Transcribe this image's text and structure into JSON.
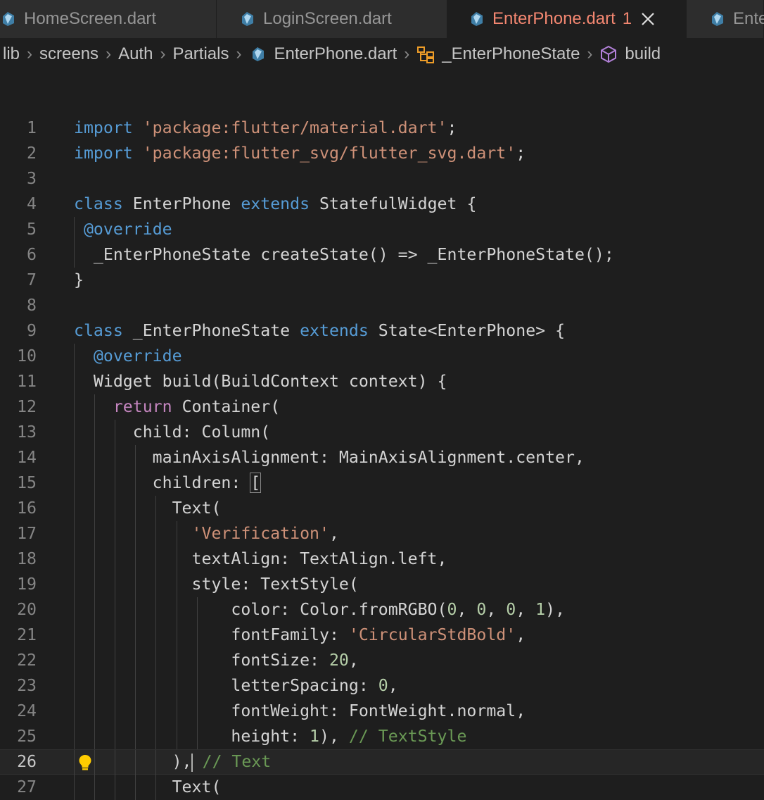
{
  "tabs": [
    {
      "label": "HomeScreen.dart",
      "active": false
    },
    {
      "label": "LoginScreen.dart",
      "active": false
    },
    {
      "label": "EnterPhone.dart",
      "active": true,
      "problems": "1"
    },
    {
      "label": "Ente",
      "active": false
    }
  ],
  "breadcrumb": {
    "items": [
      "lib",
      "screens",
      "Auth",
      "Partials",
      "EnterPhone.dart",
      "_EnterPhoneState",
      "build"
    ],
    "icons": [
      "",
      "",
      "",
      "",
      "dart-file-icon",
      "class-symbol-icon",
      "method-symbol-icon"
    ]
  },
  "editor": {
    "current_line": 26,
    "lines": [
      {
        "n": "1",
        "tokens": [
          [
            "kw",
            "import"
          ],
          [
            "",
            ""
          ],
          [
            "str",
            " 'package:flutter/material.dart'"
          ],
          [
            "",
            ";"
          ]
        ]
      },
      {
        "n": "2",
        "tokens": [
          [
            "kw",
            "import"
          ],
          [
            "str",
            " 'package:flutter_svg/flutter_svg.dart'"
          ],
          [
            "",
            ";"
          ]
        ]
      },
      {
        "n": "3",
        "tokens": []
      },
      {
        "n": "4",
        "tokens": [
          [
            "kw",
            "class"
          ],
          [
            "",
            " EnterPhone "
          ],
          [
            "kw",
            "extends"
          ],
          [
            "",
            " StatefulWidget {"
          ]
        ]
      },
      {
        "n": "5",
        "tokens": [
          [
            "",
            " "
          ],
          [
            "kw",
            "@override"
          ]
        ]
      },
      {
        "n": "6",
        "tokens": [
          [
            "",
            "  _EnterPhoneState createState() => _EnterPhoneState();"
          ]
        ]
      },
      {
        "n": "7",
        "tokens": [
          [
            "",
            "}"
          ]
        ]
      },
      {
        "n": "8",
        "tokens": []
      },
      {
        "n": "9",
        "tokens": [
          [
            "kw",
            "class"
          ],
          [
            "",
            " _EnterPhoneState "
          ],
          [
            "kw",
            "extends"
          ],
          [
            "",
            " State<EnterPhone> {"
          ]
        ]
      },
      {
        "n": "10",
        "tokens": [
          [
            "",
            "  "
          ],
          [
            "kw",
            "@override"
          ]
        ]
      },
      {
        "n": "11",
        "tokens": [
          [
            "",
            "  Widget build(BuildContext context) {"
          ]
        ]
      },
      {
        "n": "12",
        "tokens": [
          [
            "",
            "    "
          ],
          [
            "kw2",
            "return"
          ],
          [
            "",
            " Container("
          ]
        ]
      },
      {
        "n": "13",
        "tokens": [
          [
            "",
            "      child: Column("
          ]
        ]
      },
      {
        "n": "14",
        "tokens": [
          [
            "",
            "        mainAxisAlignment: MainAxisAlignment.center,"
          ]
        ]
      },
      {
        "n": "15",
        "tokens": [
          [
            "",
            "        children: "
          ],
          [
            "box",
            "["
          ]
        ]
      },
      {
        "n": "16",
        "tokens": [
          [
            "",
            "          Text("
          ]
        ]
      },
      {
        "n": "17",
        "tokens": [
          [
            "",
            "            "
          ],
          [
            "str",
            "'Verification'"
          ],
          [
            "",
            ","
          ]
        ]
      },
      {
        "n": "18",
        "tokens": [
          [
            "",
            "            textAlign: TextAlign.left,"
          ]
        ]
      },
      {
        "n": "19",
        "tokens": [
          [
            "",
            "            style: TextStyle("
          ]
        ]
      },
      {
        "n": "20",
        "tokens": [
          [
            "",
            "                color: Color.fromRGBO("
          ],
          [
            "num",
            "0"
          ],
          [
            "",
            ", "
          ],
          [
            "num",
            "0"
          ],
          [
            "",
            ", "
          ],
          [
            "num",
            "0"
          ],
          [
            "",
            ", "
          ],
          [
            "num",
            "1"
          ],
          [
            "",
            "),"
          ]
        ]
      },
      {
        "n": "21",
        "tokens": [
          [
            "",
            "                fontFamily: "
          ],
          [
            "str",
            "'CircularStdBold'"
          ],
          [
            "",
            ","
          ]
        ]
      },
      {
        "n": "22",
        "tokens": [
          [
            "",
            "                fontSize: "
          ],
          [
            "num",
            "20"
          ],
          [
            "",
            ","
          ]
        ]
      },
      {
        "n": "23",
        "tokens": [
          [
            "",
            "                letterSpacing: "
          ],
          [
            "num",
            "0"
          ],
          [
            "",
            ","
          ]
        ]
      },
      {
        "n": "24",
        "tokens": [
          [
            "",
            "                fontWeight: FontWeight.normal,"
          ]
        ]
      },
      {
        "n": "25",
        "tokens": [
          [
            "",
            "                height: "
          ],
          [
            "num",
            "1"
          ],
          [
            "",
            "), "
          ],
          [
            "cmt",
            "// TextStyle"
          ]
        ]
      },
      {
        "n": "26",
        "tokens": [
          [
            "",
            "          ),"
          ],
          [
            "cursor",
            ""
          ],
          [
            "",
            " "
          ],
          [
            "cmt",
            "// Text"
          ]
        ]
      },
      {
        "n": "27",
        "tokens": [
          [
            "",
            "          Text("
          ]
        ]
      }
    ]
  },
  "colors": {
    "background": "#1e1e1e",
    "tab_active_text": "#f48771",
    "keyword": "#569cd6",
    "string": "#ce9178",
    "number": "#b5cea8",
    "comment": "#6a9955",
    "dart_icon": "#40c4ff"
  }
}
